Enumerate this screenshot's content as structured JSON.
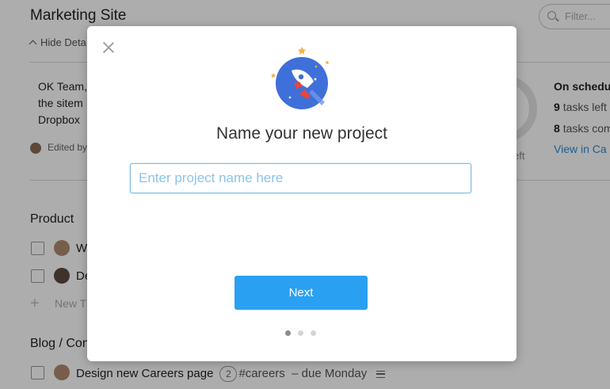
{
  "page": {
    "title": "Marketing Site",
    "filter_placeholder": "Filter...",
    "hide_details_label": "Hide Deta",
    "description_lines": [
      "OK Team,",
      "the sitem",
      "Dropbox"
    ],
    "edited_by": "Edited by",
    "progress_partial_label": "eft",
    "schedule": {
      "title": "On schedu",
      "tasks_left_count": "9",
      "tasks_left_label": "tasks left",
      "tasks_completed_count": "8",
      "tasks_completed_label": "tasks com",
      "calendar_link": "View in Ca"
    },
    "sections": [
      {
        "name": "Product",
        "tasks": [
          "W",
          "De"
        ],
        "new_task_label": "New T"
      },
      {
        "name": "Blog / Con",
        "tasks": [
          {
            "name": "Design new Careers page",
            "comments": "2",
            "tag": "#careers",
            "due": "– due Monday"
          }
        ]
      }
    ]
  },
  "modal": {
    "title": "Name your new project",
    "input_placeholder": "Enter project name here",
    "input_value": "",
    "next_button": "Next",
    "steps_total": 3,
    "active_step": 1,
    "colors": {
      "accent": "#2aa0f2",
      "rocket_circle": "#3f6fd8",
      "rocket_flame": "#e8463c",
      "stars": "#f2b24a"
    }
  }
}
